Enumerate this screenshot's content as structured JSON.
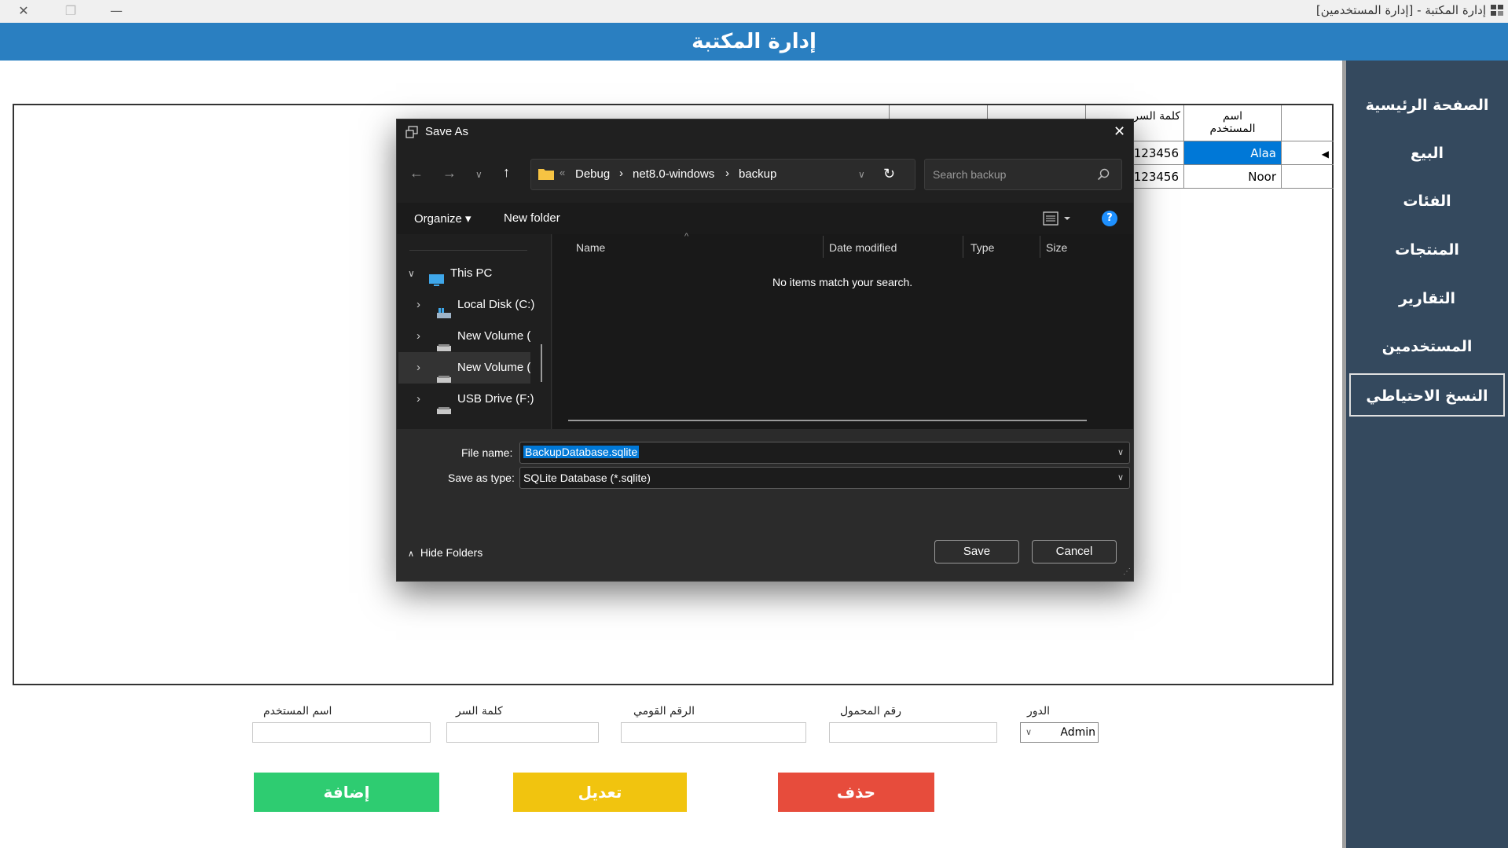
{
  "window": {
    "title": "إدارة المكتبة - [إدارة المستخدمين]",
    "controls": {
      "close": "✕",
      "restore": "❐",
      "minimize": "—"
    }
  },
  "header": {
    "title": "إدارة المكتبة"
  },
  "sidebar": {
    "items": [
      {
        "label": "الصفحة الرئيسية"
      },
      {
        "label": "البيع"
      },
      {
        "label": "الفئات"
      },
      {
        "label": "المنتجات"
      },
      {
        "label": "التقارير"
      },
      {
        "label": "المستخدمين"
      },
      {
        "label": "النسخ الاحتياطي",
        "active": true
      }
    ]
  },
  "grid": {
    "columns": [
      "اسم المستخدم",
      "كلمة السر",
      "",
      "",
      ""
    ],
    "rows": [
      {
        "username": "Alaa",
        "password": "123456",
        "selected": true
      },
      {
        "username": "Noor",
        "password": "123456",
        "selected": false
      }
    ]
  },
  "form": {
    "username_label": "اسم المستخدم",
    "password_label": "كلمة السر",
    "national_id_label": "الرقم القومي",
    "mobile_label": "رقم المحمول",
    "role_label": "الدور",
    "role_value": "Admin",
    "add_button": "إضافة",
    "edit_button": "تعديل",
    "delete_button": "حذف"
  },
  "dialog": {
    "title": "Save As",
    "breadcrumb": [
      "Debug",
      "net8.0-windows",
      "backup"
    ],
    "search_placeholder": "Search backup",
    "toolbar": {
      "organize": "Organize",
      "new_folder": "New folder"
    },
    "tree": [
      {
        "label": "This PC",
        "icon": "pc-icon"
      },
      {
        "label": "Local Disk (C:)",
        "icon": "disk-icon"
      },
      {
        "label": "New Volume (I",
        "icon": "drive-icon"
      },
      {
        "label": "New Volume (I",
        "icon": "drive-icon"
      },
      {
        "label": "USB Drive (F:)",
        "icon": "usb-icon"
      }
    ],
    "columns": {
      "name": "Name",
      "date": "Date modified",
      "type": "Type",
      "size": "Size"
    },
    "empty_message": "No items match your search.",
    "file_name_label": "File name:",
    "file_name_value": "BackupDatabase.sqlite",
    "save_type_label": "Save as type:",
    "save_type_value": "SQLite Database (*.sqlite)",
    "hide_folders": "Hide Folders",
    "save_button": "Save",
    "cancel_button": "Cancel"
  },
  "colors": {
    "header": "#2a7fc1",
    "sidebar": "#34495e",
    "add": "#2ecc71",
    "edit": "#f1c40f",
    "delete": "#e74c3c",
    "selection": "#0078d7",
    "dialog_bg": "#202020"
  }
}
